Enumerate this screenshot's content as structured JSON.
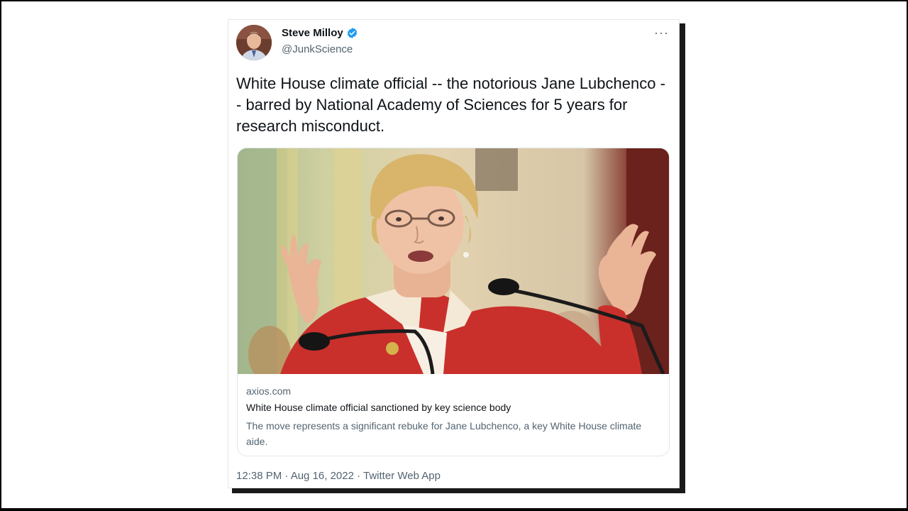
{
  "tweet": {
    "author": {
      "name": "Steve Milloy",
      "handle": "@JunkScience",
      "verified_icon": "verified-badge-icon"
    },
    "more_icon": "more-options-icon",
    "more_label": "···",
    "text": "White House climate official -- the notorious Jane Lubchenco -- barred by National Academy of Sciences for 5 years for research misconduct.",
    "card": {
      "domain": "axios.com",
      "title": "White House climate official sanctioned by key science body",
      "description": "The move represents a significant rebuke for Jane Lubchenco, a key White House climate aide."
    },
    "meta": "12:38 PM · Aug 16, 2022 · Twitter Web App"
  },
  "colors": {
    "verified": "#1d9bf0",
    "text": "#0f1419",
    "secondary": "#536471",
    "jacket": "#c9302c"
  }
}
